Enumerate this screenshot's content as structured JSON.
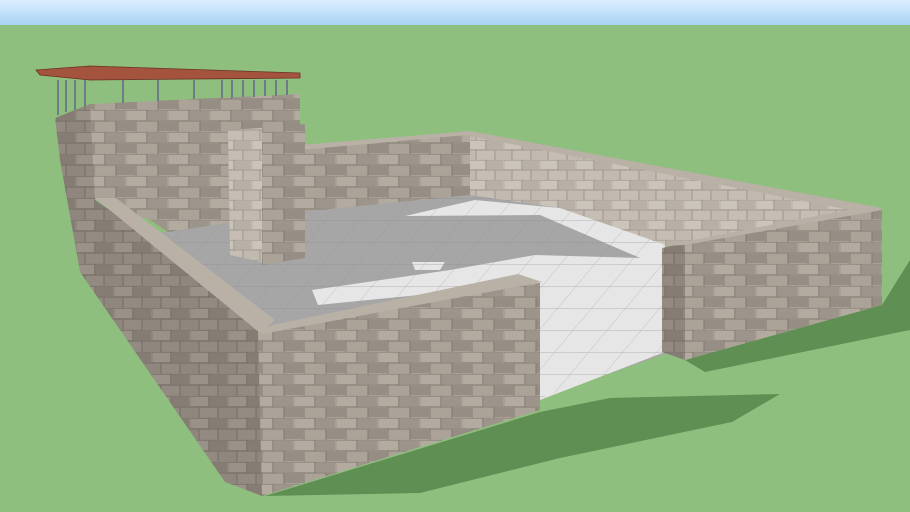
{
  "scene": {
    "subject": "stone-walled-courtyard-model",
    "colors": {
      "sky_top": "#dcefff",
      "sky_bottom": "#a9d2f5",
      "ground": "#8fbf7f",
      "shadow": "#5f8f52",
      "wall_face": "#a89f95",
      "wall_light": "#c2bab0",
      "wall_dark": "#8a8178",
      "wall_top": "#b9b1a6",
      "floor_shade": "#a6a6a6",
      "floor_lit": "#e6e6e6",
      "roof": "#a4533f",
      "post": "#6d7c86"
    }
  }
}
